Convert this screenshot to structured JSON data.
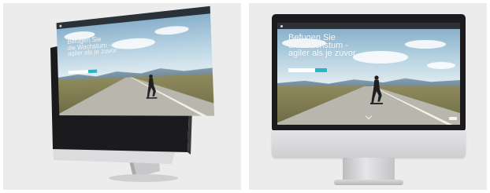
{
  "images": [
    {
      "view": "angled",
      "website": {
        "brand": "",
        "nav_links": [],
        "hero_lines": [
          "Befugen Sie",
          "die Wachstum -",
          "agiler als je zuvor"
        ],
        "email_placeholder": "",
        "cta_label": ""
      }
    },
    {
      "view": "front",
      "website": {
        "brand": "",
        "nav_links": [],
        "hero_lines": [
          "Befugen Sie",
          "die Wachstum -",
          "agiler als je zuvor"
        ],
        "email_placeholder": "",
        "cta_label": ""
      }
    }
  ],
  "colors": {
    "panel_background": "#ececec",
    "bezel": "#1b1b1d",
    "cta_button": "#29b7c8"
  }
}
